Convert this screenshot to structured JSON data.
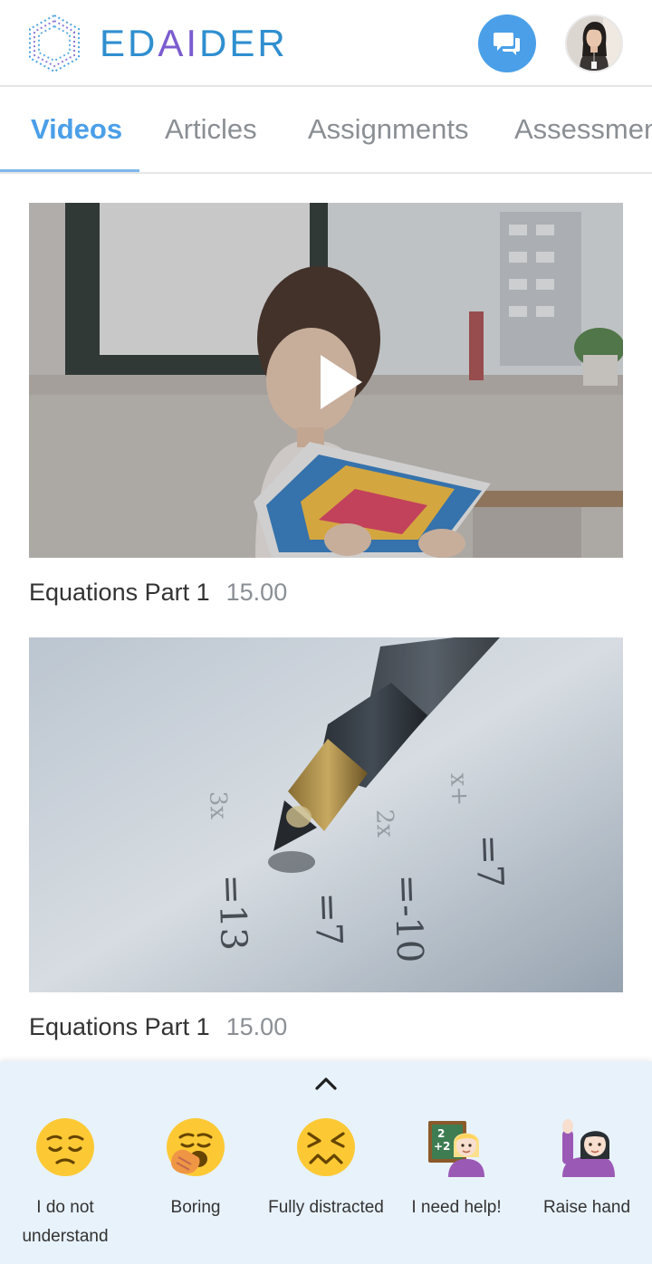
{
  "brand": {
    "name_prefix": "ED",
    "name_ai": "AI",
    "name_suffix": "DER"
  },
  "header": {
    "chat_icon": "chat-bubbles-icon",
    "avatar_icon": "user-avatar"
  },
  "tabs": [
    {
      "label": "Videos",
      "active": true
    },
    {
      "label": "Articles",
      "active": false
    },
    {
      "label": "Assignments",
      "active": false
    },
    {
      "label": "Assessments",
      "active": false
    }
  ],
  "videos": [
    {
      "title": "Equations Part 1",
      "duration": "15.00",
      "thumbnail": "girl-reading-book",
      "play_icon": "play-icon"
    },
    {
      "title": "Equations Part 1",
      "duration": "15.00",
      "thumbnail": "pen-on-equations-paper"
    }
  ],
  "reactions": {
    "collapse_icon": "chevron-up-icon",
    "items": [
      {
        "label": "I do not understand",
        "icon": "pensive-face-icon"
      },
      {
        "label": "Boring",
        "icon": "yawning-face-icon"
      },
      {
        "label": "Fully distracted",
        "icon": "confounded-face-icon"
      },
      {
        "label": "I need help!",
        "icon": "teacher-icon"
      },
      {
        "label": "Raise hand",
        "icon": "raising-hand-icon"
      }
    ]
  },
  "colors": {
    "accent": "#4a9fe8",
    "panel_bg": "#e8f2fb",
    "muted_text": "#8a8f94",
    "brand_blue": "#2f8fd0",
    "brand_purple": "#7c5ccf"
  }
}
